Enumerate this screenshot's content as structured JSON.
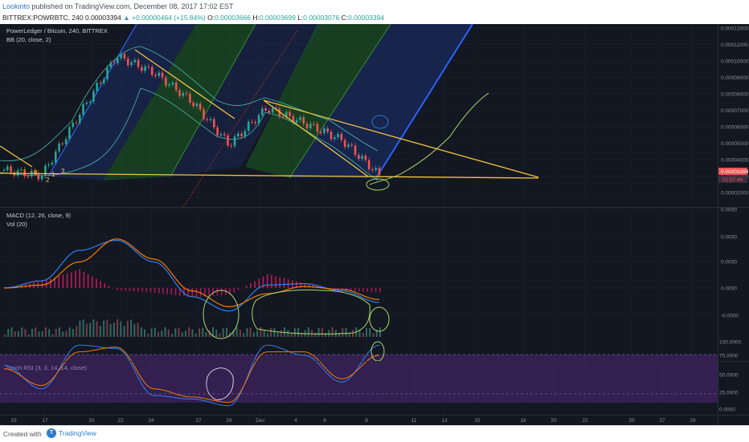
{
  "header": {
    "author": "Lookinto",
    "published_text": "published on TradingView.com, December 08, 2017 17:02 EST",
    "symbol_line": "BITTREX:POWRBTC, 240",
    "last": "0.00003394",
    "change": "▲ +0.00000464 (+15.84%)",
    "ohlc": {
      "open_label": "O:",
      "open": "0.00003666",
      "high_label": "H:",
      "high": "0.00003699",
      "low_label": "L:",
      "low": "0.00003076",
      "close_label": "C:",
      "close": "0.00003394"
    }
  },
  "legends": {
    "main": "PowerLedger / Bitcoin, 240, BITTREX",
    "bb": "BB (20, close, 2)",
    "macd": "MACD (12, 26, close, 9)",
    "vol": "Vol (20)",
    "stoch": "Stoch RSI (3, 3, 14, 14, close)"
  },
  "price_axis": {
    "ticks": [
      "0.00012000",
      "0.00011000",
      "0.00010000",
      "0.00009000",
      "0.00008000",
      "0.00007000",
      "0.00006000",
      "0.00005000",
      "0.00004000",
      "0.00003000",
      "0.00002000"
    ],
    "last_price_label": "0.00003394",
    "countdown_label": "01:57:44"
  },
  "macd_axis": {
    "ticks": [
      "0.0000",
      "0.0000",
      "0.0000",
      "0.0000",
      "-0.0000"
    ]
  },
  "stoch_axis": {
    "ticks": [
      "100.0000",
      "75.0000",
      "50.0000",
      "25.0000",
      "0.0000"
    ]
  },
  "time_axis": {
    "labels": [
      "15",
      "17",
      "20",
      "22",
      "24",
      "27",
      "29",
      "Dec",
      "4",
      "6",
      "8",
      "11",
      "13",
      "15",
      "18",
      "20",
      "22",
      "25",
      "27",
      "29"
    ]
  },
  "chart_annotations": {
    "wave_labels": [
      "3",
      "2",
      "1",
      "3"
    ]
  },
  "footer": {
    "created_with": "Created with",
    "brand": "TradingView"
  },
  "colors": {
    "background": "#131722",
    "candle_up": "#26a69a",
    "candle_down": "#ef5350",
    "trendline": "#f0c340",
    "pitchfork_green": "#2e7d32",
    "pitchfork_blue": "#2962ff",
    "stoch_band": "#5b2a8a",
    "macd_line": "#2f80ed",
    "signal_line": "#f57c00",
    "annotation": "#a8d86a"
  },
  "chart_data": [
    {
      "type": "line",
      "title": "PowerLedger / Bitcoin, 240, BITTREX",
      "x": [
        "15",
        "17",
        "20",
        "22",
        "24",
        "27",
        "29",
        "Dec",
        "4",
        "6",
        "8"
      ],
      "series": [
        {
          "name": "close",
          "values": [
            3.7e-05,
            3.35e-05,
            7e-05,
            0.000105,
            9.5e-05,
            7.8e-05,
            5.2e-05,
            7.4e-05,
            6.5e-05,
            5.5e-05,
            3.39e-05
          ]
        }
      ],
      "ylim": [
        1.5e-05,
        0.000123
      ]
    },
    {
      "type": "line",
      "title": "MACD (12, 26, close, 9)",
      "x": [
        "15",
        "17",
        "20",
        "22",
        "24",
        "27",
        "29",
        "Dec",
        "4",
        "6",
        "8"
      ],
      "series": [
        {
          "name": "MACD",
          "values": [
            0.0,
            0.5,
            2.6,
            3.3,
            1.8,
            -0.6,
            -1.6,
            0.2,
            0.3,
            -0.2,
            -1.0
          ]
        },
        {
          "name": "Signal",
          "values": [
            0.0,
            0.2,
            1.8,
            3.4,
            2.0,
            -0.2,
            -1.3,
            -0.4,
            0.1,
            -0.1,
            -0.8
          ]
        }
      ]
    },
    {
      "type": "line",
      "title": "Stoch RSI (3, 3, 14, 14, close)",
      "x": [
        "15",
        "17",
        "20",
        "22",
        "24",
        "27",
        "29",
        "Dec",
        "4",
        "6",
        "8"
      ],
      "series": [
        {
          "name": "K",
          "values": [
            65,
            30,
            95,
            90,
            20,
            15,
            5,
            95,
            80,
            40,
            95
          ]
        },
        {
          "name": "D",
          "values": [
            60,
            35,
            85,
            92,
            30,
            18,
            10,
            85,
            85,
            45,
            80
          ]
        }
      ],
      "ylim": [
        0,
        100
      ]
    }
  ]
}
